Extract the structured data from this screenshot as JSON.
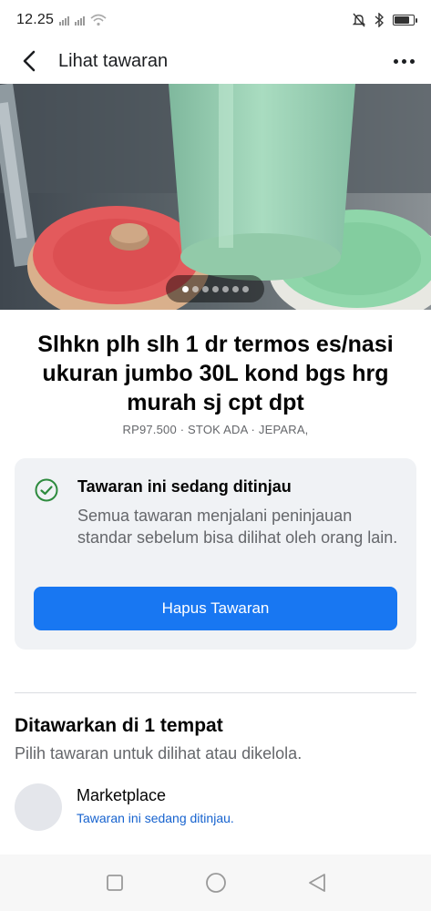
{
  "status_bar": {
    "time": "12.25"
  },
  "header": {
    "title": "Lihat tawaran",
    "icons": [
      "back-arrow-icon",
      "more-options-icon"
    ]
  },
  "gallery": {
    "image_count": 7,
    "active_index": 0
  },
  "listing": {
    "title": "Slhkn plh slh 1 dr termos es/nasi ukuran jumbo 30L kond bgs hrg murah sj cpt dpt",
    "meta": "RP97.500 · STOK ADA · JEPARA,"
  },
  "review": {
    "title": "Tawaran ini sedang ditinjau",
    "description": "Semua tawaran menjalani peninjauan standar sebelum bisa dilihat oleh orang lain.",
    "delete_label": "Hapus Tawaran"
  },
  "offered": {
    "title": "Ditawarkan di 1 tempat",
    "subtitle": "Pilih tawaran untuk dilihat atau dikelola.",
    "places": [
      {
        "name": "Marketplace",
        "status": "Tawaran ini sedang ditinjau."
      }
    ]
  },
  "colors": {
    "accent": "#1877f2",
    "link": "#1763cf",
    "success": "#2e8b3e",
    "card_bg": "#f0f2f5"
  }
}
